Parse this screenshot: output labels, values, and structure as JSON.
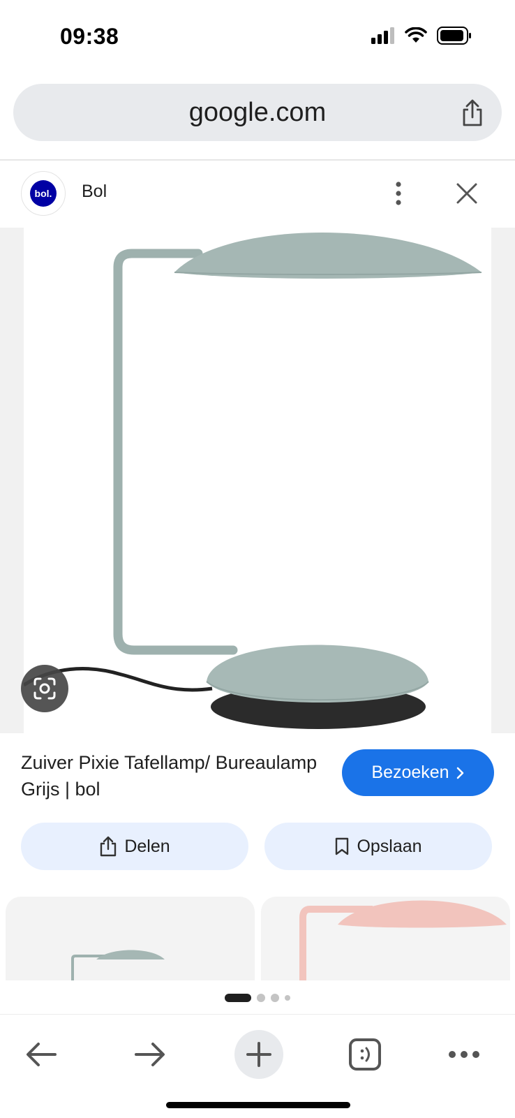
{
  "status_bar": {
    "time": "09:38"
  },
  "browser": {
    "url": "google.com"
  },
  "source": {
    "name": "Bol",
    "logo_text": "bol."
  },
  "product": {
    "title": "Zuiver Pixie Tafellamp/ Bureaulamp Grijs | bol",
    "visit_label": "Bezoeken",
    "share_label": "Delen",
    "save_label": "Opslaan"
  },
  "carousel": {
    "pages": 4,
    "active": 0
  },
  "colors": {
    "accent": "#1a73e8",
    "pill_bg": "#e8f0fe",
    "url_bar_bg": "#e8eaed",
    "lamp": "#9eb1ae",
    "lamp_pink": "#f2c4bd"
  },
  "icons": [
    "signal-icon",
    "wifi-icon",
    "battery-icon",
    "share-icon",
    "more-vert-icon",
    "close-icon",
    "lens-icon",
    "chevron-right-icon",
    "bookmark-icon",
    "back-icon",
    "forward-icon",
    "plus-icon",
    "tabs-icon",
    "more-horiz-icon"
  ]
}
